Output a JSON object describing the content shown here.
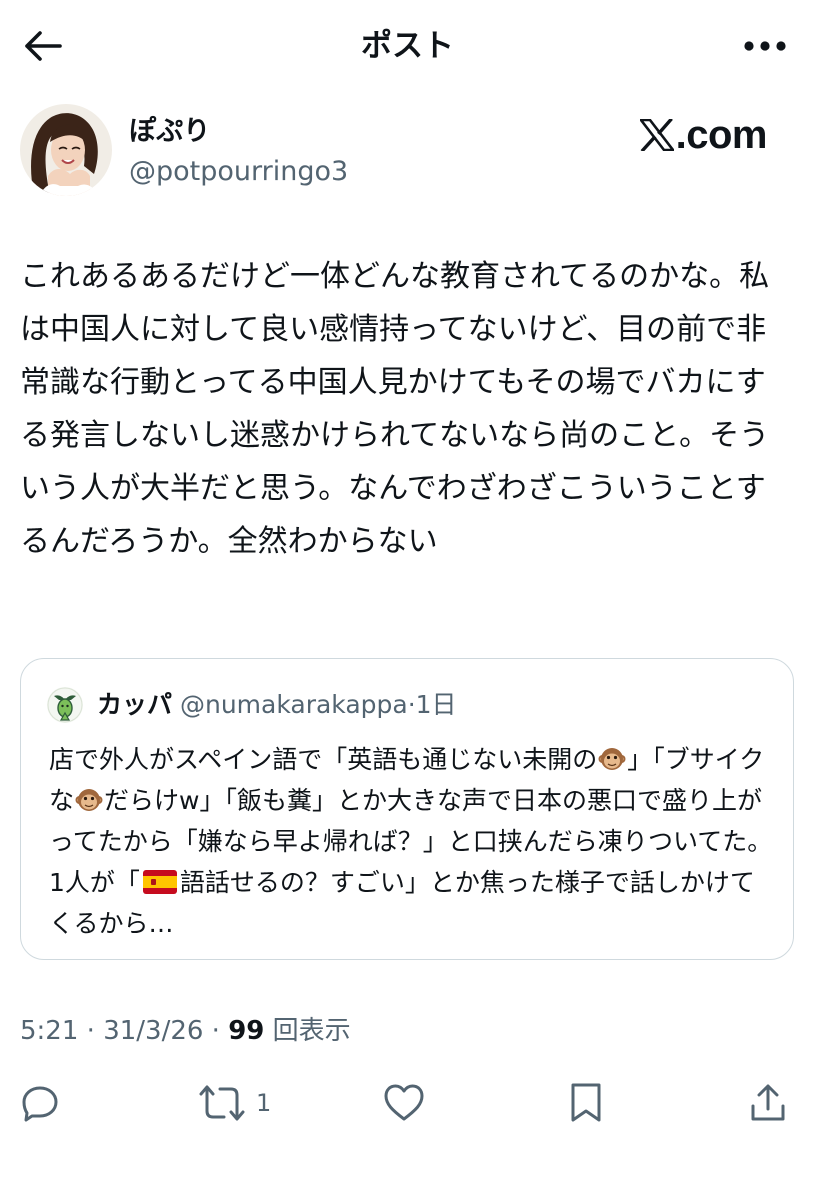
{
  "header": {
    "title": "ポスト",
    "back_icon": "arrow-left-icon",
    "more_icon": "more-horizontal-icon"
  },
  "author": {
    "display_name": "ぽぷり",
    "handle": "@potpourringo3"
  },
  "brand": {
    "text": ".com",
    "logo_icon": "x-logo-icon"
  },
  "post": {
    "text": "これあるあるだけど一体どんな教育されてるのかな。私は中国人に対して良い感情持ってないけど、目の前で非常識な行動とってる中国人見かけてもその場でバカにする発言しないし迷惑かけられてないなら尚のこと。そういう人が大半だと思う。なんでわざわざこういうことするんだろうか。全然わからない"
  },
  "quote": {
    "name": "カッパ",
    "handle": "@numakarakappa",
    "separator": "·",
    "time": "1日",
    "text_parts": {
      "p1": "店で外人がスペイン語で「英語も通じない未開の",
      "p2": "」「ブサイクな",
      "p3": "だらけw」「飯も糞」とか大きな声で日本の悪口で盛り上がってたから「嫌なら早よ帰れば？」と口挟んだら凍りついてた。1人が「",
      "p4": "語話せるの？すごい」とか焦った様子で話しかけてくるから…"
    },
    "emoji": {
      "monkey": "monkey-face-icon",
      "flag": "spain-flag-icon"
    }
  },
  "meta": {
    "time": "5:21",
    "sep": " · ",
    "date": "31/3/26",
    "views_count": "99",
    "views_label": "回表示"
  },
  "actions": {
    "reply_icon": "reply-icon",
    "repost_icon": "repost-icon",
    "repost_count": "1",
    "like_icon": "heart-icon",
    "bookmark_icon": "bookmark-icon",
    "share_icon": "share-icon"
  },
  "colors": {
    "text": "#0f1419",
    "secondary": "#536471",
    "border": "#cfd9de"
  }
}
